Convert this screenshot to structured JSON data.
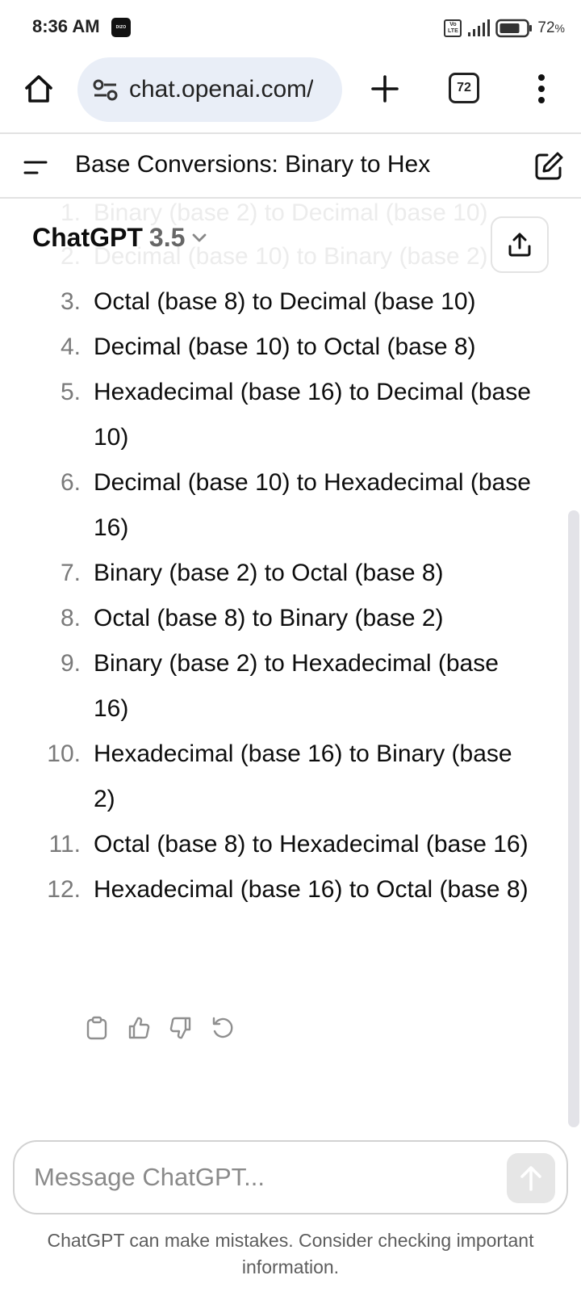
{
  "status_bar": {
    "time": "8:36 AM",
    "app_badge": "DIZO",
    "volte": "Vo LTE",
    "battery_percent": "72",
    "battery_unit": "%"
  },
  "browser": {
    "url": "chat.openai.com/",
    "tab_count": "72"
  },
  "chat": {
    "title": "Base Conversions: Binary to Hex",
    "model_name": "ChatGPT",
    "model_version": "3.5"
  },
  "answer_items": [
    {
      "num": "1.",
      "text": "Binary (base 2) to Decimal (base 10)"
    },
    {
      "num": "2.",
      "text": "Decimal (base 10) to Binary (base 2)"
    },
    {
      "num": "3.",
      "text": "Octal (base 8) to Decimal (base 10)"
    },
    {
      "num": "4.",
      "text": "Decimal (base 10) to Octal (base 8)"
    },
    {
      "num": "5.",
      "text": "Hexadecimal (base 16) to Decimal (base 10)"
    },
    {
      "num": "6.",
      "text": "Decimal (base 10) to Hexadecimal (base 16)"
    },
    {
      "num": "7.",
      "text": "Binary (base 2) to Octal (base 8)"
    },
    {
      "num": "8.",
      "text": "Octal (base 8) to Binary (base 2)"
    },
    {
      "num": "9.",
      "text": "Binary (base 2) to Hexadecimal (base 16)"
    },
    {
      "num": "10.",
      "text": "Hexadecimal (base 16) to Binary (base 2)"
    },
    {
      "num": "11.",
      "text": "Octal (base 8) to Hexadecimal (base 16)"
    },
    {
      "num": "12.",
      "text": "Hexadecimal (base 16) to Octal (base 8)"
    }
  ],
  "composer": {
    "placeholder": "Message ChatGPT..."
  },
  "footer": {
    "disclaimer": "ChatGPT can make mistakes. Consider checking important information."
  },
  "icons": {
    "home": "home-icon",
    "site_settings": "tune-icon",
    "new_tab": "plus-icon",
    "menu": "more-vertical-icon",
    "sidebar": "sidebar-menu-icon",
    "new_chat": "edit-icon",
    "share": "share-icon",
    "copy": "clipboard-icon",
    "like": "thumbs-up-icon",
    "dislike": "thumbs-down-icon",
    "regenerate": "refresh-icon",
    "send": "arrow-up-icon"
  }
}
